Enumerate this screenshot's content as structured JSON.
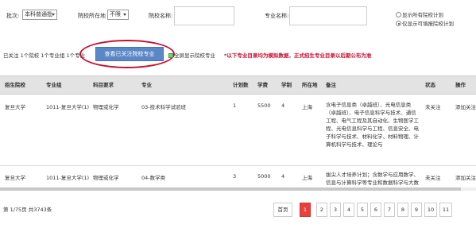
{
  "filters": {
    "batch_label": "批次:",
    "batch_value": "本科普通批",
    "location_label": "院校所在地",
    "location_value": "不限",
    "school_name_label": "院校名称:",
    "school_name_value": "",
    "major_name_label": "专业名称:",
    "major_name_value": "",
    "radio_all": "显示所有院校计划",
    "radio_selectable": "仅显示可填报院校计划"
  },
  "toolbar": {
    "summary": "已关注 1个院校 1个专业组 1个专业",
    "view_button": "查看已关注院校专业",
    "fullscreen": "全屏显示院校专业",
    "notice": "*以下专业目录均为模拟数据，正式招生专业目录以后期公布为准"
  },
  "table": {
    "headers": [
      "招生院校",
      "专业组",
      "科目要求",
      "专业",
      "计划数",
      "学费",
      "学制",
      "所在地",
      "备注",
      "状态",
      "操作"
    ],
    "rows": [
      {
        "school": "复旦大学",
        "group": "1011-复旦大学(1)",
        "subject": "物理或化学",
        "major": "03-技术科学试验班",
        "plan": "1",
        "fee": "5500",
        "years": "4",
        "location": "上海",
        "remark": "含电子信息类（卓越班）、光电信息类（卓越班）、电子信息科学与技术、通信工程、电气工程及其自动化、生物医学工程、光电信息科学与工程、信息安全、电子科学与技术、材料化学、材料物理、计算机科学与技术、理论与",
        "status": "未关注",
        "action": "添加关注"
      },
      {
        "school": "复旦大学",
        "group": "1011-复旦大学(1)",
        "subject": "物理或化学",
        "major": "04-数学类",
        "plan": "3",
        "fee": "5000",
        "years": "4",
        "location": "上海",
        "remark": "拔尖人才培养计划；含数学与应用数学、信息与计算科学等专业和数据科学与大数据技",
        "status": "未关注",
        "action": "添加关注"
      }
    ]
  },
  "pagination": {
    "info": "第 1/75页   共3743条",
    "first": "首页",
    "pages": [
      "1",
      "2",
      "3",
      "4",
      "5",
      "6",
      "7",
      "8",
      "9",
      "10",
      "11"
    ],
    "current": "1"
  },
  "colors": {
    "accent_button": "#5b87c7",
    "notice_red": "#c8102e",
    "active_page": "#e8413c",
    "header_bg": "#e3e3e3"
  }
}
